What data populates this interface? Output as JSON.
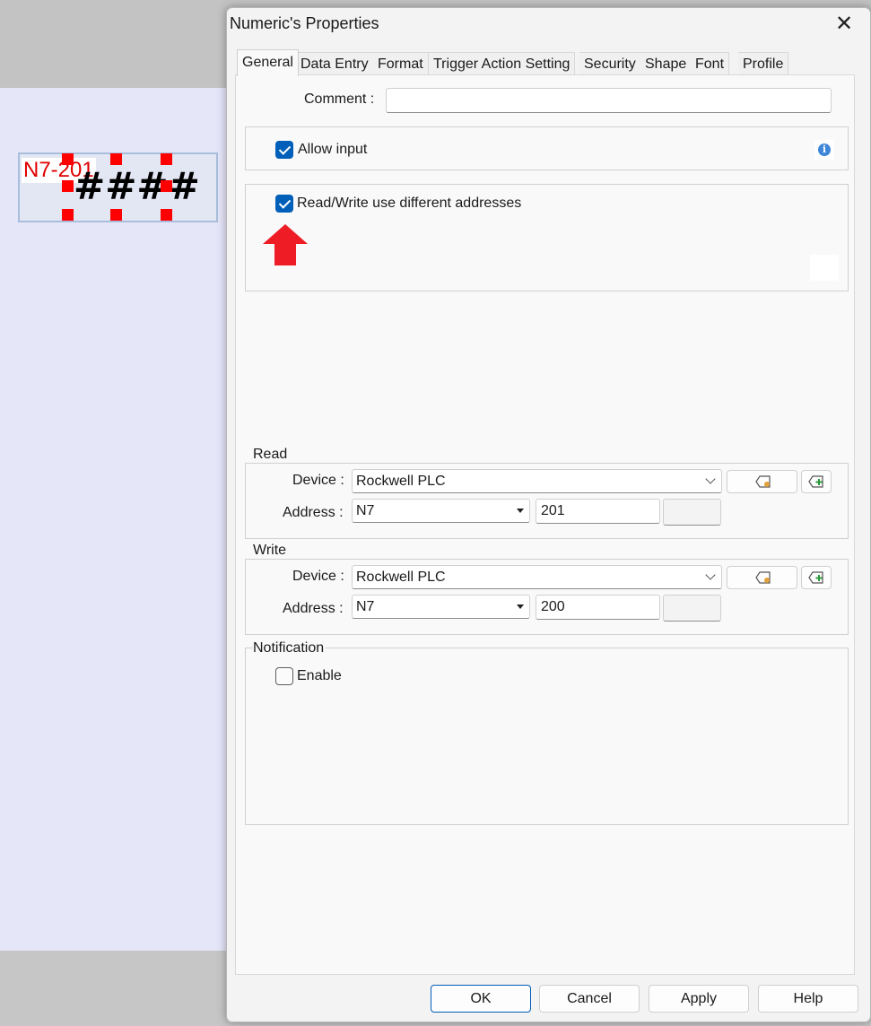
{
  "canvas": {
    "object": {
      "address_tag": "N7-201",
      "value_mask": "####"
    }
  },
  "dialog": {
    "title": "Numeric's Properties",
    "tabs": [
      {
        "label": "General",
        "active": true
      },
      {
        "label": "Data Entry"
      },
      {
        "label": "Format"
      },
      {
        "label": "Trigger Action Setting"
      },
      {
        "label": "Security"
      },
      {
        "label": "Shape"
      },
      {
        "label": "Font"
      },
      {
        "label": "Profile"
      }
    ],
    "comment": {
      "label": "Comment :",
      "value": ""
    },
    "allow_input": {
      "label": "Allow input",
      "checked": true
    },
    "rw_different": {
      "label": "Read/Write use different addresses",
      "checked": true
    },
    "read": {
      "title": "Read",
      "device_label": "Device :",
      "device": "Rockwell PLC",
      "address_label": "Address :",
      "address_type": "N7",
      "address_value": "201"
    },
    "write": {
      "title": "Write",
      "device_label": "Device :",
      "device": "Rockwell PLC",
      "address_label": "Address :",
      "address_type": "N7",
      "address_value": "200"
    },
    "notification": {
      "title": "Notification",
      "enable_label": "Enable",
      "enabled": false
    },
    "buttons": {
      "ok": "OK",
      "cancel": "Cancel",
      "apply": "Apply",
      "help": "Help"
    }
  },
  "colors": {
    "accent": "#005fb8",
    "arrow": "#ee1c25",
    "handle": "#ff0000"
  }
}
